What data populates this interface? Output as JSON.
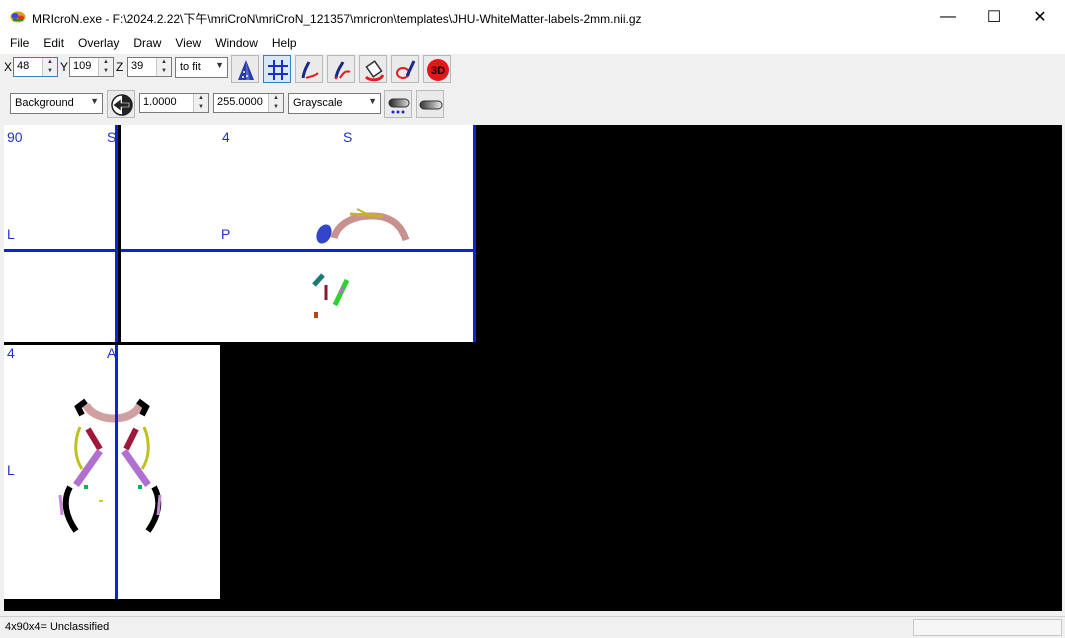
{
  "window": {
    "title": "MRIcroN.exe - F:\\2024.2.22\\下午\\mriCroN\\mriCroN_121357\\mricron\\templates\\JHU-WhiteMatter-labels-2mm.nii.gz",
    "minimize_glyph": "—",
    "maximize_glyph": "☐",
    "close_glyph": "✕"
  },
  "menu": [
    "File",
    "Edit",
    "Overlay",
    "Draw",
    "View",
    "Window",
    "Help"
  ],
  "coords": {
    "x_label": "X",
    "x_value": "48",
    "y_label": "Y",
    "y_value": "109",
    "z_label": "Z",
    "z_value": "39",
    "zoom": "to fit"
  },
  "layer": {
    "selected": "Background",
    "min": "1.0000",
    "max": "255.0000",
    "colormap": "Grayscale"
  },
  "views": {
    "coronal": {
      "tl": "90",
      "top": "S",
      "left": "L"
    },
    "sagittal": {
      "tl": "4",
      "top": "S",
      "left": "P"
    },
    "axial": {
      "tl": "4",
      "top": "A",
      "left": "L"
    }
  },
  "icons": {
    "app": "brain-logo-icon",
    "tool1": "triangle-cone-icon",
    "tool2": "crosshair-grid-icon",
    "tool3": "pen-draw-icon",
    "tool4": "pen-erase-icon",
    "tool5": "fill-bucket-icon",
    "tool6": "ellipse-pen-icon",
    "tool7": "render-3d-icon"
  },
  "status": {
    "text": "4x90x4= Unclassified"
  }
}
